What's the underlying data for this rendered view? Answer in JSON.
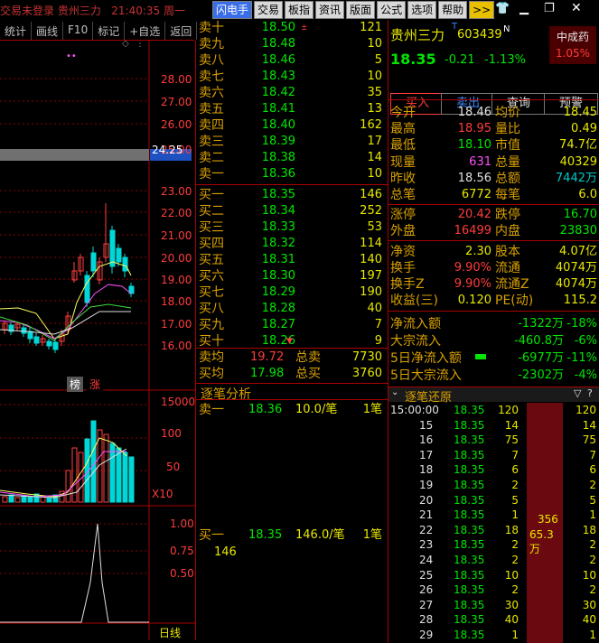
{
  "topbar": {
    "title": "交易未登录  贵州三力",
    "time": "21:40:35",
    "weekday": "周一"
  },
  "toolbar": [
    "闪电手",
    "交易",
    "板指",
    "资讯",
    "版面",
    "公式",
    "选项",
    "帮助",
    ">>"
  ],
  "left_tabs": [
    "统计",
    "画线",
    "F10",
    "标记",
    "+自选",
    "返回"
  ],
  "price_axis": [
    "28.00",
    "27.00",
    "26.00",
    "25.00",
    "24.25",
    "23.00",
    "22.00",
    "21.00",
    "20.00",
    "19.00",
    "18.00",
    "17.00",
    "16.00"
  ],
  "volume_axis": [
    "15000",
    "100",
    "50",
    "X10"
  ],
  "lower_axis": [
    "1.00",
    "0.75",
    "0.50"
  ],
  "chart_badges": [
    "榜",
    "涨"
  ],
  "bottom_tab": "日线",
  "order_book": {
    "asks": [
      {
        "label": "卖十",
        "price": "18.50",
        "volume": "121",
        "mark": "±"
      },
      {
        "label": "卖九",
        "price": "18.48",
        "volume": "10",
        "mark": ""
      },
      {
        "label": "卖八",
        "price": "18.46",
        "volume": "5",
        "mark": ""
      },
      {
        "label": "卖七",
        "price": "18.43",
        "volume": "10",
        "mark": ""
      },
      {
        "label": "卖六",
        "price": "18.42",
        "volume": "35",
        "mark": ""
      },
      {
        "label": "卖五",
        "price": "18.41",
        "volume": "13",
        "mark": ""
      },
      {
        "label": "卖四",
        "price": "18.40",
        "volume": "162",
        "mark": ""
      },
      {
        "label": "卖三",
        "price": "18.39",
        "volume": "17",
        "mark": ""
      },
      {
        "label": "卖二",
        "price": "18.38",
        "volume": "14",
        "mark": ""
      },
      {
        "label": "卖一",
        "price": "18.36",
        "volume": "10",
        "mark": ""
      }
    ],
    "bids": [
      {
        "label": "买一",
        "price": "18.35",
        "volume": "146",
        "mark": ""
      },
      {
        "label": "买二",
        "price": "18.34",
        "volume": "252",
        "mark": ""
      },
      {
        "label": "买三",
        "price": "18.33",
        "volume": "53",
        "mark": ""
      },
      {
        "label": "买四",
        "price": "18.32",
        "volume": "114",
        "mark": ""
      },
      {
        "label": "买五",
        "price": "18.31",
        "volume": "140",
        "mark": ""
      },
      {
        "label": "买六",
        "price": "18.30",
        "volume": "197",
        "mark": ""
      },
      {
        "label": "买七",
        "price": "18.29",
        "volume": "190",
        "mark": ""
      },
      {
        "label": "买八",
        "price": "18.28",
        "volume": "40",
        "mark": ""
      },
      {
        "label": "买九",
        "price": "18.27",
        "volume": "7",
        "mark": ""
      },
      {
        "label": "买十",
        "price": "18.26",
        "volume": "9",
        "mark": "▼"
      }
    ],
    "summary": [
      {
        "l1": "卖均",
        "v1": "19.72",
        "l2": "总卖",
        "v2": "7730"
      },
      {
        "l1": "买均",
        "v1": "17.98",
        "l2": "总买",
        "v2": "3760"
      }
    ],
    "tick_title": "逐笔分析",
    "tick_sell": {
      "side": "卖一",
      "price": "18.36",
      "qty": "10.0/笔",
      "count": "1笔"
    },
    "tick_buy": {
      "side": "买一",
      "price": "18.35",
      "qty": "146.0/笔",
      "count": "1笔",
      "extra": "146"
    }
  },
  "stock": {
    "name": "贵州三力",
    "code": "603439",
    "sup": "T",
    "n": "N",
    "tag": "中成药",
    "tag_pct": "1.05%",
    "price": "18.35",
    "change": "-0.21",
    "pct": "-1.13%"
  },
  "actions": [
    "买入",
    "卖出",
    "查询",
    "预警"
  ],
  "stats": [
    {
      "l1": "今开",
      "v1": "18.46",
      "l2": "均价",
      "v2": "18.45"
    },
    {
      "l1": "最高",
      "v1": "18.95",
      "l2": "量比",
      "v2": "0.49"
    },
    {
      "l1": "最低",
      "v1": "18.10",
      "l2": "市值",
      "v2": "74.7亿"
    },
    {
      "l1": "现量",
      "v1": "631",
      "l2": "总量",
      "v2": "40329"
    },
    {
      "l1": "昨收",
      "v1": "18.56",
      "l2": "总额",
      "v2": "7442万"
    },
    {
      "l1": "总笔",
      "v1": "6772",
      "l2": "每笔",
      "v2": "6.0"
    },
    {
      "l1": "涨停",
      "v1": "20.42",
      "l2": "跌停",
      "v2": "16.70"
    },
    {
      "l1": "外盘",
      "v1": "16499",
      "l2": "内盘",
      "v2": "23830"
    },
    {
      "l1": "净资",
      "v1": "2.30",
      "l2": "股本",
      "v2": "4.07亿"
    },
    {
      "l1": "换手",
      "v1": "9.90%",
      "l2": "流通",
      "v2": "4074万"
    },
    {
      "l1": "换手Z",
      "v1": "9.90%",
      "l2": "流通Z",
      "v2": "4074万"
    },
    {
      "l1": "收益(三)",
      "v1": "0.120",
      "l2": "PE(动)",
      "v2": "115.2"
    }
  ],
  "flows": [
    {
      "label": "净流入额",
      "value": "-1322万",
      "pct": "-18%"
    },
    {
      "label": "大宗流入",
      "value": "-460.8万",
      "pct": "-6%"
    },
    {
      "label": "5日净流入额",
      "value": "-6977万",
      "pct": "-11%"
    },
    {
      "label": "5日大宗流入",
      "value": "-2302万",
      "pct": "-4%"
    }
  ],
  "ticks_title": "逐笔还原",
  "ticks": [
    {
      "time": "15:00:00",
      "price": "18.35",
      "vol": "120"
    },
    {
      "time": "15",
      "price": "18.35",
      "vol": "14"
    },
    {
      "time": "16",
      "price": "18.35",
      "vol": "75"
    },
    {
      "time": "17",
      "price": "18.35",
      "vol": "7"
    },
    {
      "time": "18",
      "price": "18.35",
      "vol": "6"
    },
    {
      "time": "19",
      "price": "18.35",
      "vol": "2"
    },
    {
      "time": "20",
      "price": "18.35",
      "vol": "5"
    },
    {
      "time": "21",
      "price": "18.35",
      "vol": "1"
    },
    {
      "time": "22",
      "price": "18.35",
      "vol": "18"
    },
    {
      "time": "23",
      "price": "18.35",
      "vol": "2"
    },
    {
      "time": "24",
      "price": "18.35",
      "vol": "2"
    },
    {
      "time": "25",
      "price": "18.35",
      "vol": "10"
    },
    {
      "time": "26",
      "price": "18.35",
      "vol": "2"
    },
    {
      "time": "27",
      "price": "18.35",
      "vol": "30"
    },
    {
      "time": "28",
      "price": "18.35",
      "vol": "40"
    },
    {
      "time": "29",
      "price": "18.35",
      "vol": "1"
    }
  ],
  "ticks_right": [
    "120",
    "14",
    "75",
    "7",
    "6",
    "2",
    "5",
    "1",
    "18",
    "2",
    "2",
    "10",
    "2",
    "30",
    "40",
    "1"
  ],
  "bigorder": {
    "vol": "356",
    "amt": "65.3万"
  }
}
